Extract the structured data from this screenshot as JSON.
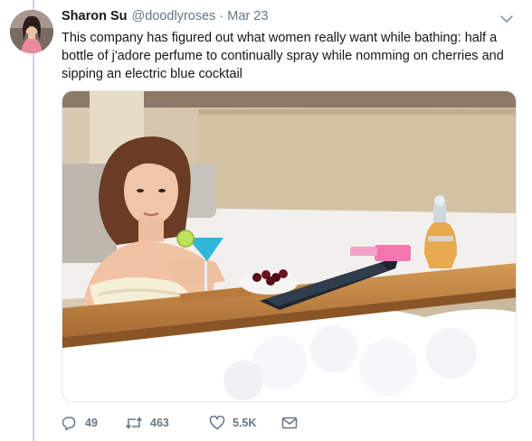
{
  "tweet": {
    "author": {
      "display_name": "Sharon Su",
      "handle": "@doodlyroses",
      "separator": "·",
      "date": "Mar 23"
    },
    "text": "This company has figured out what women really want while bathing: half a bottle of j'adore perfume to continually spray while nomming on cherries and sipping an electric blue cocktail",
    "media": {
      "type": "photo",
      "description_icon": "bath-tray-photo"
    },
    "actions": {
      "reply": {
        "icon": "reply-icon",
        "count": "49"
      },
      "retweet": {
        "icon": "retweet-icon",
        "count": "463"
      },
      "like": {
        "icon": "heart-icon",
        "count": "5.5K"
      },
      "dm": {
        "icon": "envelope-icon"
      }
    },
    "colors": {
      "text": "#14171a",
      "secondary": "#657786",
      "thread_line": "#ccd6dd"
    }
  }
}
